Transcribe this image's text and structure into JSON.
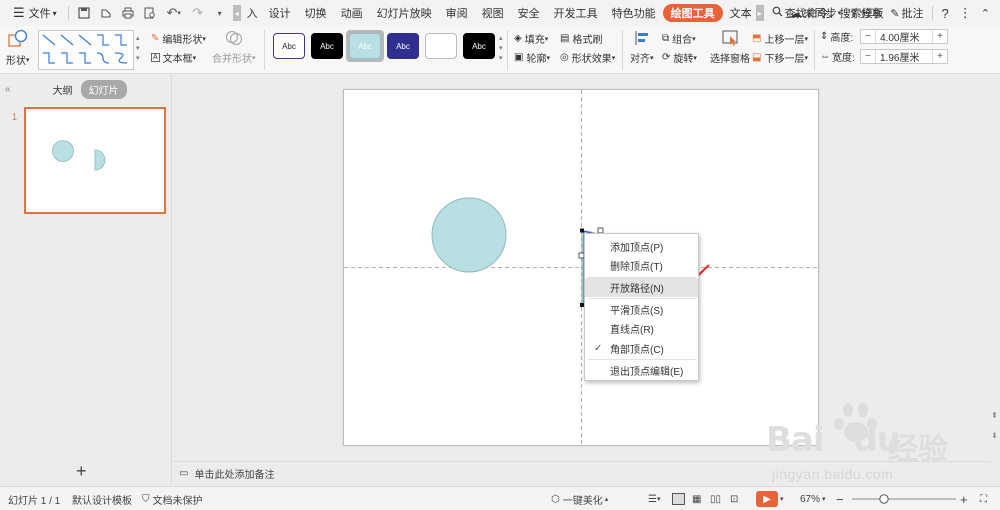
{
  "menubar": {
    "file_label": "文件",
    "tabs": [
      "入",
      "设计",
      "切换",
      "动画",
      "幻灯片放映",
      "审阅",
      "视图",
      "安全",
      "开发工具",
      "特色功能",
      "绘图工具",
      "文本"
    ],
    "active_tab": "绘图工具",
    "search_label": "查找命令、搜索模板",
    "sync_label": "未同步",
    "share_label": "分享",
    "comment_label": "批注",
    "help_label": "?"
  },
  "ribbon": {
    "shape_label": "形状",
    "edit_shape_label": "编辑形状",
    "textbox_label": "文本框",
    "merge_shape_label": "合并形状",
    "style_boxes": [
      "Abc",
      "Abc",
      "Abc",
      "Abc",
      "",
      "Abc"
    ],
    "fill_label": "填充",
    "format_brush_label": "格式刷",
    "outline_label": "轮廓",
    "shape_effect_label": "形状效果",
    "align_label": "对齐",
    "group_label": "组合",
    "rotate_label": "旋转",
    "selection_pane_label": "选择窗格",
    "bring_forward_label": "上移一层",
    "send_backward_label": "下移一层",
    "height_label": "高度:",
    "height_value": "4.00厘米",
    "width_label": "宽度:",
    "width_value": "1.96厘米",
    "colors": {
      "accent": "#e8623a"
    }
  },
  "left_panel": {
    "outline_tab": "大纲",
    "slides_tab": "幻灯片",
    "slide_number": "1",
    "add_label": "+"
  },
  "context_menu": {
    "items": [
      {
        "label": "添加顶点(P)",
        "checked": false,
        "highlighted": false
      },
      {
        "label": "删除顶点(T)",
        "checked": false,
        "highlighted": false
      },
      {
        "label": "开放路径(N)",
        "checked": false,
        "highlighted": true
      },
      {
        "label": "平滑顶点(S)",
        "checked": false,
        "highlighted": false
      },
      {
        "label": "直线点(R)",
        "checked": false,
        "highlighted": false
      },
      {
        "label": "角部顶点(C)",
        "checked": true,
        "highlighted": false
      },
      {
        "label": "退出顶点编辑(E)",
        "checked": false,
        "highlighted": false
      }
    ]
  },
  "notes": {
    "placeholder": "单击此处添加备注"
  },
  "status": {
    "slide_info": "幻灯片 1 / 1",
    "template": "默认设计模板",
    "protection": "文档未保护",
    "beautify": "一键美化",
    "zoom": "67%"
  },
  "watermark": {
    "brand_text": "Bai",
    "brand_text2": "du",
    "cn_text": "经验",
    "url": "jingyan.baidu.com"
  },
  "canvas": {
    "shape_fill": "#b8dfe1",
    "shape_stroke": "#8fb9bc"
  }
}
